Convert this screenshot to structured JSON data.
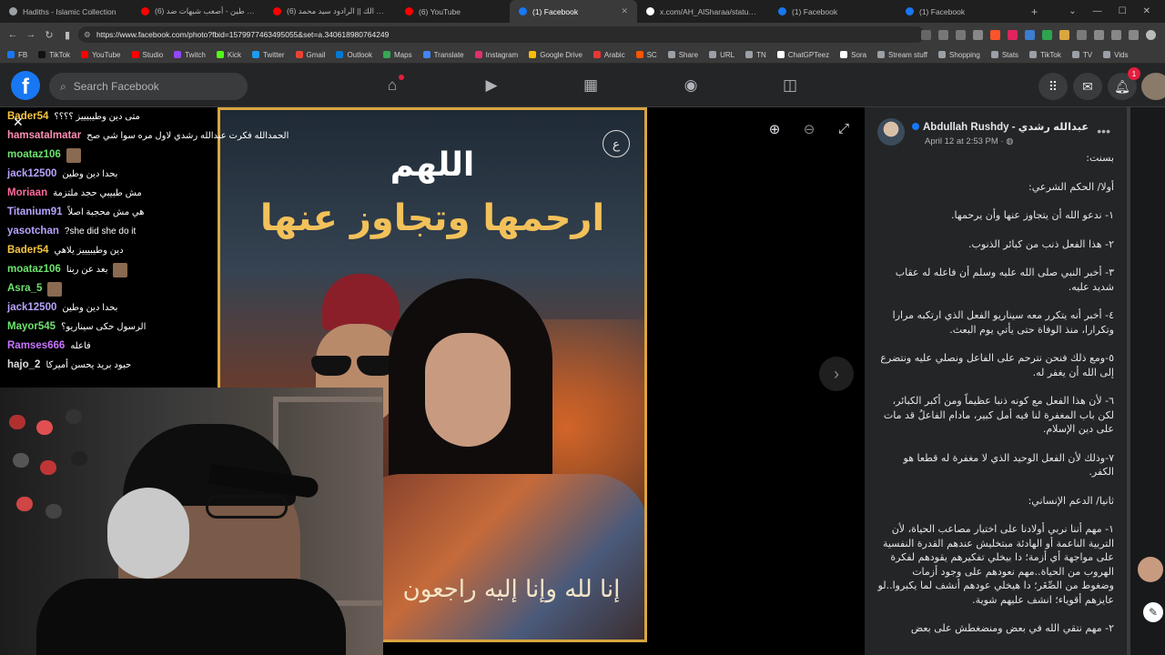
{
  "browser": {
    "tabs": [
      {
        "label": "Hadiths - Islamic Collection",
        "color": "#9aa0a6",
        "active": false
      },
      {
        "label": "(6) دين و طين - أصعب شبهات ضد...",
        "color": "#ff0000",
        "active": false
      },
      {
        "label": "(6) موعود الك || الرادود سيد محمد...",
        "color": "#ff0000",
        "active": false
      },
      {
        "label": "(6) YouTube",
        "color": "#ff0000",
        "active": false
      },
      {
        "label": "(1) Facebook",
        "color": "#1877f2",
        "active": true
      },
      {
        "label": "x.com/AH_AlSharaa/status/204...",
        "color": "#ffffff",
        "active": false
      },
      {
        "label": "(1) Facebook",
        "color": "#1877f2",
        "active": false
      },
      {
        "label": "(1) Facebook",
        "color": "#1877f2",
        "active": false
      }
    ],
    "url": "https://www.facebook.com/photo?fbid=1579977463495055&set=a.340618980764249",
    "bookmarks": [
      {
        "label": "FB",
        "color": "#1877f2"
      },
      {
        "label": "TikTok",
        "color": "#111111"
      },
      {
        "label": "YouTube",
        "color": "#ff0000"
      },
      {
        "label": "Studio",
        "color": "#ff0000"
      },
      {
        "label": "Twitch",
        "color": "#9146ff"
      },
      {
        "label": "Kick",
        "color": "#53fc18"
      },
      {
        "label": "Twitter",
        "color": "#1d9bf0"
      },
      {
        "label": "Gmail",
        "color": "#ea4335"
      },
      {
        "label": "Outlook",
        "color": "#0078d4"
      },
      {
        "label": "Maps",
        "color": "#34a853"
      },
      {
        "label": "Translate",
        "color": "#4285f4"
      },
      {
        "label": "Instagram",
        "color": "#e1306c"
      },
      {
        "label": "Google Drive",
        "color": "#fbbc04"
      },
      {
        "label": "Arabic",
        "color": "#e53935"
      },
      {
        "label": "SC",
        "color": "#ff5500"
      },
      {
        "label": "Share",
        "color": "#9aa0a6"
      },
      {
        "label": "URL",
        "color": "#9aa0a6"
      },
      {
        "label": "TN",
        "color": "#9aa0a6"
      },
      {
        "label": "ChatGPTeez",
        "color": "#ffffff"
      },
      {
        "label": "Sora",
        "color": "#ffffff"
      },
      {
        "label": "Stream stuff",
        "color": "#9aa0a6"
      },
      {
        "label": "Shopping",
        "color": "#9aa0a6"
      },
      {
        "label": "Stats",
        "color": "#9aa0a6"
      },
      {
        "label": "TikTok",
        "color": "#9aa0a6"
      },
      {
        "label": "TV",
        "color": "#9aa0a6"
      },
      {
        "label": "Vids",
        "color": "#9aa0a6"
      }
    ]
  },
  "facebook": {
    "search_placeholder": "Search Facebook",
    "notification_count": "1",
    "post": {
      "author": "Abdullah Rushdy - عبدالله رشدي",
      "date": "April 12 at 2:53 PM · ",
      "paragraphs": [
        "بسنت:",
        "أولا/ الحكم الشرعي:",
        "١- ندعو الله أن يتجاوز عنها وأن يرحمها.",
        "٢- هذا الفعل ذنب من كبائر الذنوب.",
        "٣- أخبر النبي صلى الله عليه وسلم أن فاعله له عقاب شديد عليه.",
        "٤- أخبر أنه يتكرر معه سيناريو الفعل الذي ارتكبه مرارا وتكرارا، منذ الوفاة حتى يأتي يوم البعث.",
        "٥-ومع ذلك فنحن نترحم على الفاعل ونصلي عليه ونتضرع إلى الله أن يغفر له.",
        "٦- لأن هذا الفعل مع كونه ذنبا عظيماً ومن أكبر الكبائر، لكن باب المغفرة لنا فيه أمل كبير، مادام الفاعلُ قد مات على دين الإسلام.",
        "٧-وذلك لأن الفعل الوحيد الذي لا مغفرة له قطعا هو الكفر.",
        "ثانيا/ الدعم الإنساني:",
        "١- مهم أننا نربي أولادنا على اختيار مصاعب الحياة، لأن التربية الناعمة أو الهادئة مبتخليش عندهم القدرة النفسية على مواجهة أي أزمة؛ دا بيخلي تفكيرهم يقودهم لفكرة الهروب من الحياة..مهم نعودهم على وجود أزمات وضغوط من الصِّغَر؛ دا هيخلي عودهم أنشف لما يكبروا..لو عايزهم أقوياء؛ انشف عليهم شوية.",
        "٢- مهم نتقي الله في بعض ومنضغطش على بعض"
      ]
    },
    "photo": {
      "title_line1": "اللهم",
      "title_line2": "ارحمها وتجاوز عنها",
      "calligraphy": "إنا لله وإنا إليه راجعون",
      "border_color": "#d9a640"
    }
  },
  "stream_chat": [
    {
      "user": "Bader54",
      "color": "#f5c542",
      "text": "متى دين وطيبيييز ؟؟؟؟",
      "avatar": false
    },
    {
      "user": "hamsatalmatar",
      "color": "#ff8fb1",
      "text": "الحمدالله فكرت عبدالله رشدي لاول مره سوا شي صح",
      "avatar": false
    },
    {
      "user": "moataz106",
      "color": "#6ee36e",
      "text": "",
      "avatar": true
    },
    {
      "user": "jack12500",
      "color": "#b9a3ff",
      "text": "بحدا دين وطين",
      "avatar": false
    },
    {
      "user": "Moriaan",
      "color": "#ff6b9b",
      "text": "مش طبيبي حجد ملتزمة",
      "avatar": false
    },
    {
      "user": "Titanium91",
      "color": "#b9a3ff",
      "text": "هي مش محجبة اصلاً",
      "avatar": false
    },
    {
      "user": "yasotchan",
      "color": "#b9a3ff",
      "text": "she did she do it?",
      "avatar": false
    },
    {
      "user": "Bader54",
      "color": "#f5c542",
      "text": "دين وطيبيييز يلاهي",
      "avatar": false
    },
    {
      "user": "moataz106",
      "color": "#6ee36e",
      "text": "بعد عن ربنا",
      "avatar": true
    },
    {
      "user": "Asra_5",
      "color": "#6ee36e",
      "text": "",
      "avatar": true
    },
    {
      "user": "jack12500",
      "color": "#b9a3ff",
      "text": "بحدا دين وطين",
      "avatar": false
    },
    {
      "user": "Mayor545",
      "color": "#6ee36e",
      "text": "الرسول حكى سيناريو؟",
      "avatar": false
    },
    {
      "user": "Ramses666",
      "color": "#c774ff",
      "text": "فاعله",
      "avatar": false
    },
    {
      "user": "hajo_2",
      "color": "#dddddd",
      "text": "حبود بريد يحسن أميركا",
      "avatar": false
    }
  ]
}
